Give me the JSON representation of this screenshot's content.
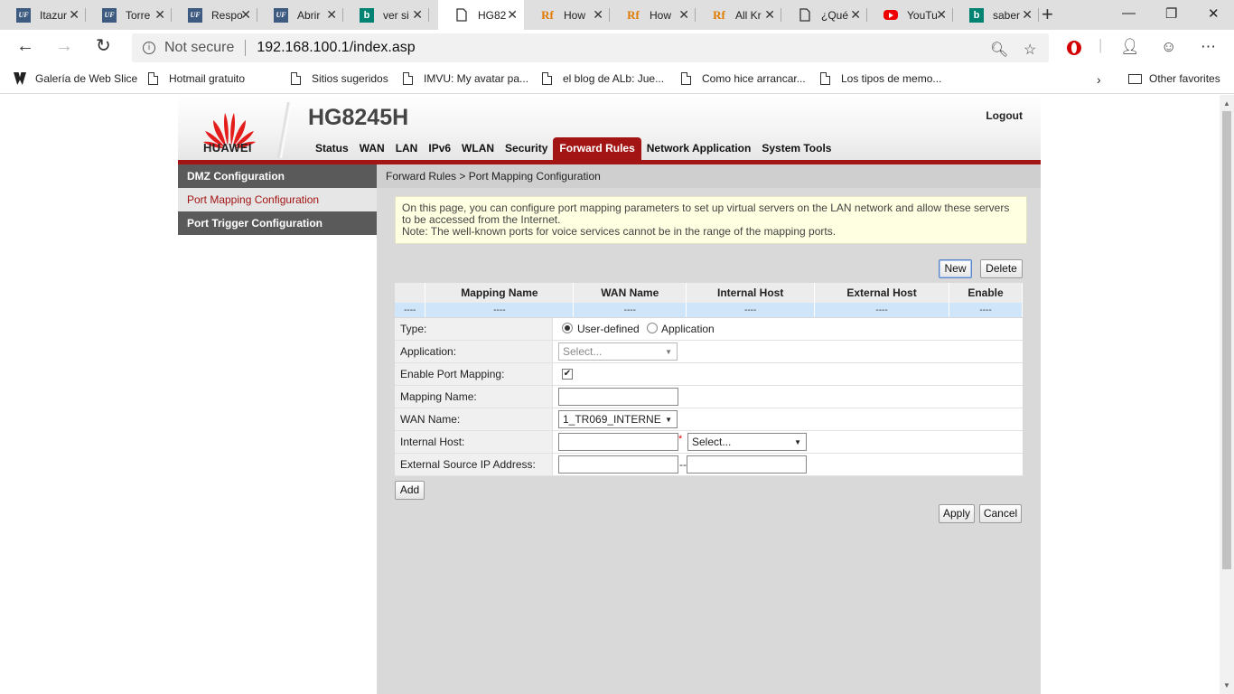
{
  "browser": {
    "tabs": [
      {
        "title": "Itazur",
        "icon": "uf"
      },
      {
        "title": "Torre",
        "icon": "uf"
      },
      {
        "title": "Respo",
        "icon": "uf"
      },
      {
        "title": "Abrir",
        "icon": "uf"
      },
      {
        "title": "ver si",
        "icon": "bing"
      },
      {
        "title": "HG82",
        "icon": "page"
      },
      {
        "title": "How",
        "icon": "rf"
      },
      {
        "title": "How",
        "icon": "rf"
      },
      {
        "title": "All Kr",
        "icon": "rf"
      },
      {
        "title": "¿Qué",
        "icon": "page"
      },
      {
        "title": "YouTu",
        "icon": "youtube"
      },
      {
        "title": "saber",
        "icon": "bing"
      }
    ],
    "active_tab_index": 5,
    "address": {
      "security_text": "Not secure",
      "url": "192.168.100.1/index.asp"
    },
    "bookmarks": [
      "Galería de Web Slice",
      "Hotmail gratuito",
      "Sitios sugeridos",
      "IMVU: My avatar pa...",
      "el blog de ALb: Jue...",
      "Como hice arrancar...",
      "Los tipos de memo..."
    ],
    "other_favorites": "Other favorites"
  },
  "router": {
    "brand": "HUAWEI",
    "model": "HG8245H",
    "logout": "Logout",
    "nav": [
      "Status",
      "WAN",
      "LAN",
      "IPv6",
      "WLAN",
      "Security",
      "Forward Rules",
      "Network Application",
      "System Tools"
    ],
    "nav_active": "Forward Rules",
    "brand_color": "#a31515",
    "sidebar": [
      {
        "label": "DMZ Configuration",
        "selected": false
      },
      {
        "label": "Port Mapping Configuration",
        "selected": true
      },
      {
        "label": "Port Trigger Configuration",
        "selected": false
      }
    ],
    "breadcrumb": "Forward Rules > Port Mapping Configuration",
    "note_line1": "On this page, you can configure port mapping parameters to set up virtual servers on the LAN network and allow these servers to be accessed from the Internet.",
    "note_line2": "Note: The well-known ports for voice services cannot be in the range of the mapping ports.",
    "buttons": {
      "new": "New",
      "delete": "Delete",
      "add": "Add",
      "apply": "Apply",
      "cancel": "Cancel"
    },
    "table": {
      "headers": [
        "",
        "Mapping Name",
        "WAN Name",
        "Internal Host",
        "External Host",
        "Enable"
      ],
      "row": [
        "----",
        "----",
        "----",
        "----",
        "----",
        "----"
      ]
    },
    "form": {
      "type_label": "Type:",
      "type_options": [
        "User-defined",
        "Application"
      ],
      "type_selected": "User-defined",
      "application_label": "Application:",
      "application_value": "Select...",
      "enable_label": "Enable Port Mapping:",
      "enable_checked": true,
      "mapping_name_label": "Mapping Name:",
      "mapping_name_value": "",
      "wan_name_label": "WAN Name:",
      "wan_name_value": "1_TR069_INTERNE",
      "internal_host_label": "Internal Host:",
      "internal_host_value": "",
      "internal_host_select": "Select...",
      "required_mark": "*",
      "ext_src_label": "External Source IP Address:",
      "range_separator": "--"
    }
  }
}
